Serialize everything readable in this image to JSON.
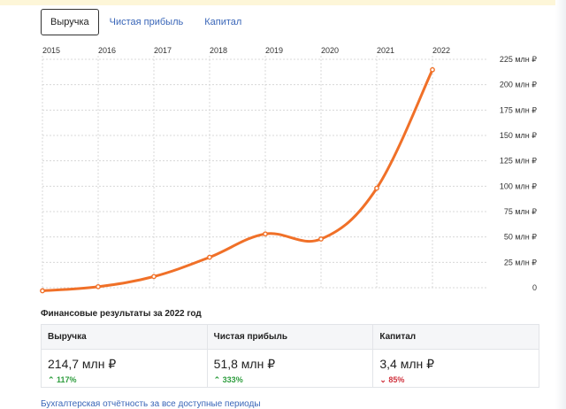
{
  "tabs": [
    {
      "label": "Выручка",
      "active": true
    },
    {
      "label": "Чистая прибыль",
      "active": false
    },
    {
      "label": "Капитал",
      "active": false
    }
  ],
  "chart_data": {
    "type": "line",
    "x": [
      "2015",
      "2016",
      "2017",
      "2018",
      "2019",
      "2020",
      "2021",
      "2022"
    ],
    "series": [
      {
        "values": [
          -3,
          1,
          11,
          30,
          53,
          48,
          98,
          214.7
        ],
        "color": "#f07028"
      }
    ],
    "ylim": [
      0,
      225
    ],
    "yticks": [
      "0",
      "25 млн ₽",
      "50 млн ₽",
      "75 млн ₽",
      "100 млн ₽",
      "125 млн ₽",
      "150 млн ₽",
      "175 млн ₽",
      "200 млн ₽",
      "225 млн ₽"
    ],
    "grid": true
  },
  "results": {
    "title": "Финансовые результаты за 2022 год",
    "columns": [
      {
        "label": "Выручка",
        "value": "214,7 млн ₽",
        "change": "117%",
        "direction": "up"
      },
      {
        "label": "Чистая прибыль",
        "value": "51,8 млн ₽",
        "change": "333%",
        "direction": "up"
      },
      {
        "label": "Капитал",
        "value": "3,4 млн ₽",
        "change": "85%",
        "direction": "down"
      }
    ]
  },
  "links": {
    "reports": "Бухгалтерская отчётность за все доступные периоды"
  },
  "colors": {
    "accent": "#f07028",
    "link": "#3a66b8",
    "up": "#2e9d3e",
    "down": "#d0343f"
  }
}
